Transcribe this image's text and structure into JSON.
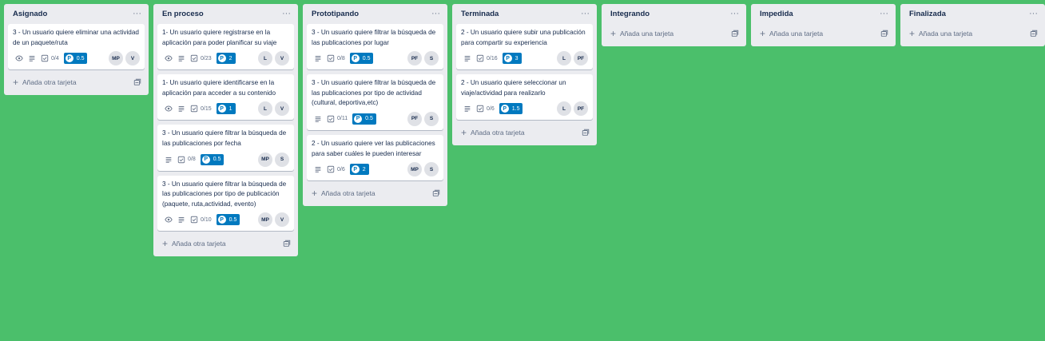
{
  "board": {
    "lists": [
      {
        "title": "Asignado",
        "menu": "···",
        "add_label": "Añada otra tarjeta",
        "cards": [
          {
            "title": "3 - Un usuario quiere eliminar una actividad de un paquete/ruta",
            "watch": true,
            "checklist": "0/4",
            "points": "0.5",
            "members": [
              "MP",
              "V"
            ]
          }
        ]
      },
      {
        "title": "En proceso",
        "menu": "···",
        "add_label": "Añada otra tarjeta",
        "cards": [
          {
            "title": "1- Un usuario quiere registrarse en la aplicación para poder planificar su viaje",
            "watch": true,
            "checklist": "0/23",
            "points": "2",
            "members": [
              "L",
              "V"
            ]
          },
          {
            "title": "1- Un usuario quiere identificarse en la aplicación para acceder a su contenido",
            "watch": true,
            "checklist": "0/15",
            "points": "1",
            "members": [
              "L",
              "V"
            ]
          },
          {
            "title": "3 - Un usuario quiere filtrar la búsqueda de las publicaciones por fecha",
            "watch": false,
            "checklist": "0/8",
            "points": "0.5",
            "members": [
              "MP",
              "S"
            ]
          },
          {
            "title": "3 - Un usuario quiere filtrar la búsqueda de las publicaciones por tipo de publicación (paquete, ruta,actividad, evento)",
            "watch": true,
            "checklist": "0/10",
            "points": "0.5",
            "members": [
              "MP",
              "V"
            ]
          }
        ]
      },
      {
        "title": "Prototipando",
        "menu": "···",
        "add_label": "Añada otra tarjeta",
        "cards": [
          {
            "title": "3 - Un usuario quiere filtrar la búsqueda de las publicaciones por lugar",
            "watch": false,
            "checklist": "0/8",
            "points": "0.5",
            "members": [
              "PF",
              "S"
            ]
          },
          {
            "title": "3 - Un usuario quiere filtrar la búsqueda de las publicaciones por tipo de actividad (cultural, deportiva,etc)",
            "watch": false,
            "checklist": "0/11",
            "points": "0.5",
            "members": [
              "PF",
              "S"
            ]
          },
          {
            "title": "2 - Un usuario quiere ver las publicaciones para saber cuáles le pueden interesar",
            "watch": false,
            "checklist": "0/6",
            "points": "2",
            "members": [
              "MP",
              "S"
            ]
          }
        ]
      },
      {
        "title": "Terminada",
        "menu": "···",
        "add_label": "Añada otra tarjeta",
        "cards": [
          {
            "title": "2 - Un usuario quiere subir una publicación para compartir su experiencia",
            "watch": false,
            "checklist": "0/16",
            "points": "3",
            "members": [
              "L",
              "PF"
            ]
          },
          {
            "title": "2 - Un usuario quiere seleccionar un viaje/actividad para realizarlo",
            "watch": false,
            "checklist": "0/6",
            "points": "1.5",
            "members": [
              "L",
              "PF"
            ]
          }
        ]
      },
      {
        "title": "Integrando",
        "menu": "···",
        "add_label": "Añada una tarjeta",
        "cards": []
      },
      {
        "title": "Impedida",
        "menu": "···",
        "add_label": "Añada una tarjeta",
        "cards": []
      },
      {
        "title": "Finalizada",
        "menu": "···",
        "add_label": "Añada una tarjeta",
        "cards": []
      }
    ]
  },
  "colors": {
    "background": "#4bbf6b",
    "list_bg": "#ebecf0",
    "points_badge": "#0079bf",
    "avatar_bg": "#dfe1e6"
  },
  "icons": {
    "watch": "eye-icon",
    "description": "description-icon",
    "checklist": "checklist-icon",
    "points": "points-icon",
    "add": "plus-icon",
    "template": "card-template-icon",
    "menu": "more-icon"
  }
}
